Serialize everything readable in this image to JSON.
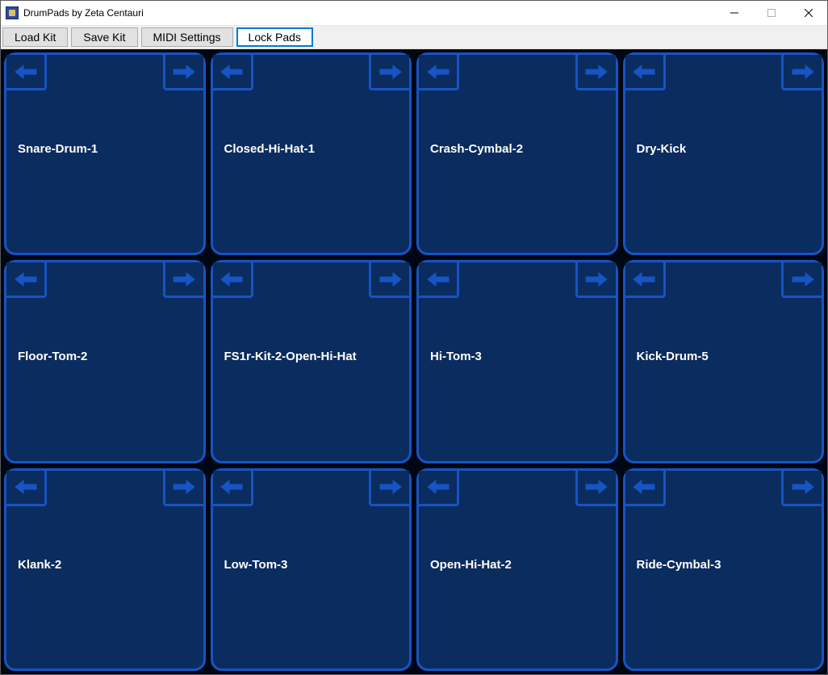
{
  "window": {
    "title": "DrumPads by Zeta Centauri"
  },
  "toolbar": {
    "load_kit": "Load Kit",
    "save_kit": "Save Kit",
    "midi_settings": "MIDI Settings",
    "lock_pads": "Lock Pads"
  },
  "pads": [
    {
      "label": "Snare-Drum-1"
    },
    {
      "label": "Closed-Hi-Hat-1"
    },
    {
      "label": "Crash-Cymbal-2"
    },
    {
      "label": "Dry-Kick"
    },
    {
      "label": "Floor-Tom-2"
    },
    {
      "label": "FS1r-Kit-2-Open-Hi-Hat"
    },
    {
      "label": "Hi-Tom-3"
    },
    {
      "label": "Kick-Drum-5"
    },
    {
      "label": "Klank-2"
    },
    {
      "label": "Low-Tom-3"
    },
    {
      "label": "Open-Hi-Hat-2"
    },
    {
      "label": "Ride-Cymbal-3"
    }
  ],
  "colors": {
    "pad_bg": "#0b2c5e",
    "pad_border": "#1754c4",
    "accent": "#0078d7"
  }
}
